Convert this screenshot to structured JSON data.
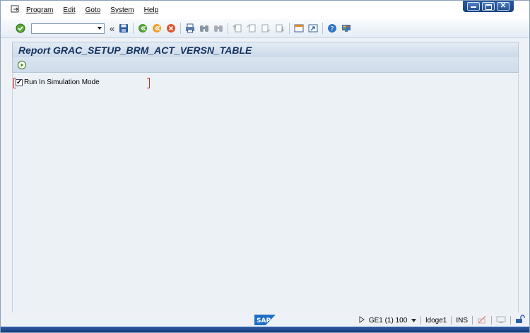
{
  "menu": {
    "items": [
      "Program",
      "Edit",
      "Goto",
      "System",
      "Help"
    ]
  },
  "window_controls": {
    "close_glyph": "✕"
  },
  "toolbar": {
    "command_field": {
      "value": ""
    },
    "icons": [
      "enter-icon",
      "save-icon",
      "back-icon",
      "exit-icon",
      "cancel-icon",
      "print-icon",
      "find-icon",
      "find-next-icon",
      "first-page-icon",
      "previous-page-icon",
      "next-page-icon",
      "last-page-icon",
      "new-session-icon",
      "shortcut-icon",
      "help-icon",
      "customize-layout-icon"
    ],
    "double_chevron": "«"
  },
  "title": {
    "text": "Report GRAC_SETUP_BRM_ACT_VERSN_TABLE"
  },
  "app_toolbar": {
    "execute_icon": "execute-icon"
  },
  "form": {
    "simulation": {
      "label": "Run In Simulation Mode",
      "checked": true,
      "check_glyph": "✓"
    }
  },
  "statusbar": {
    "system": "GE1 (1) 100",
    "server": "ldoge1",
    "mode": "INS",
    "logo_text": "SAP"
  },
  "colors": {
    "accent": "#1d4a8f",
    "title_text": "#12325f",
    "required_marker": "#d12c12"
  }
}
